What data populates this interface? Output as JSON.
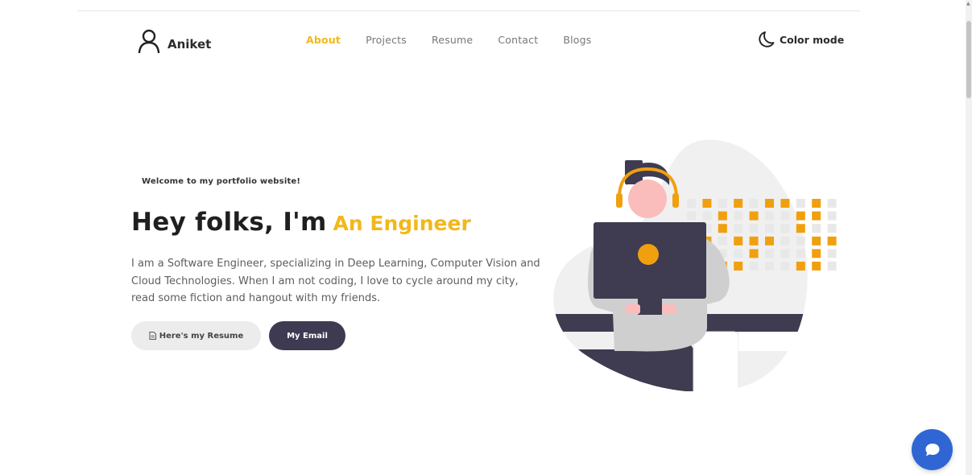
{
  "brand": {
    "name": "Aniket",
    "icon": "user-icon"
  },
  "nav": {
    "items": [
      {
        "label": "About",
        "active": true
      },
      {
        "label": "Projects",
        "active": false
      },
      {
        "label": "Resume",
        "active": false
      },
      {
        "label": "Contact",
        "active": false
      },
      {
        "label": "Blogs",
        "active": false
      }
    ]
  },
  "color_mode": {
    "label": "Color mode",
    "icon": "moon-icon"
  },
  "hero": {
    "welcome": "Welcome to my portfolio website!",
    "greeting": "Hey folks, I'm",
    "role": "An Engineer",
    "bio": "I am a Software Engineer, specializing in Deep Learning, Computer Vision and Cloud Technologies. When I am not coding, I love to cycle around my city, read some fiction and hangout with my friends."
  },
  "buttons": {
    "resume": "Here's my Resume",
    "resume_icon": "document-icon",
    "email": "My Email"
  },
  "chat": {
    "icon": "chat-icon"
  },
  "colors": {
    "accent": "#f3b71a",
    "dark": "#3e3a52",
    "chat": "#2f66d4",
    "orange": "#f0a00f"
  }
}
